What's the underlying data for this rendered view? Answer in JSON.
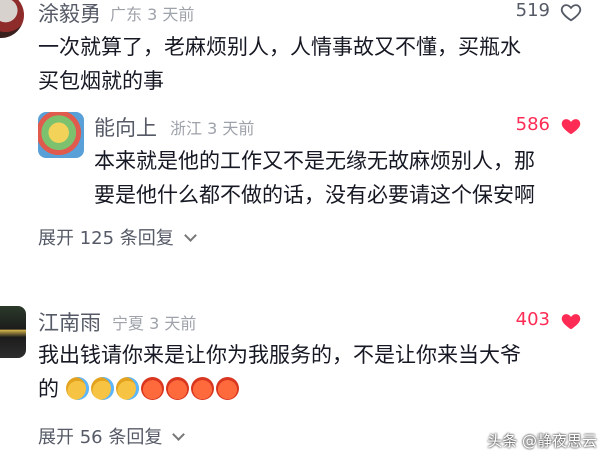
{
  "comments": [
    {
      "user": "涂毅勇",
      "location": "广东",
      "time": "3 天前",
      "likes": "519",
      "liked": false,
      "text_lines": [
        "一次就算了，老麻烦别人，人情事故又不懂，买瓶水",
        "买包烟就的事"
      ]
    },
    {
      "user": "能向上",
      "location": "浙江",
      "time": "3 天前",
      "likes": "586",
      "liked": true,
      "text_lines": [
        "本来就是他的工作又不是无缘无故麻烦别人，那",
        "要是他什么都不做的话，没有必要请这个保安啊"
      ],
      "expand_label": "展开 125 条回复"
    },
    {
      "user": "江南雨",
      "location": "宁夏",
      "time": "3 天前",
      "likes": "403",
      "liked": true,
      "text_lines": [
        "我出钱请你来是让你为我服务的，不是让你来当大爷",
        "的"
      ],
      "expand_label": "展开 56 条回复"
    }
  ],
  "emoji_row": [
    "face-with-tears-of-joy",
    "face-with-tears-of-joy",
    "face-with-tears-of-joy",
    "angry-face",
    "angry-face",
    "angry-face",
    "angry-face"
  ],
  "watermark": "头条 @静夜思云",
  "colors": {
    "like_red": "#fe2c55",
    "meta_gray": "#9ea2aa",
    "name_gray": "#555a66"
  }
}
